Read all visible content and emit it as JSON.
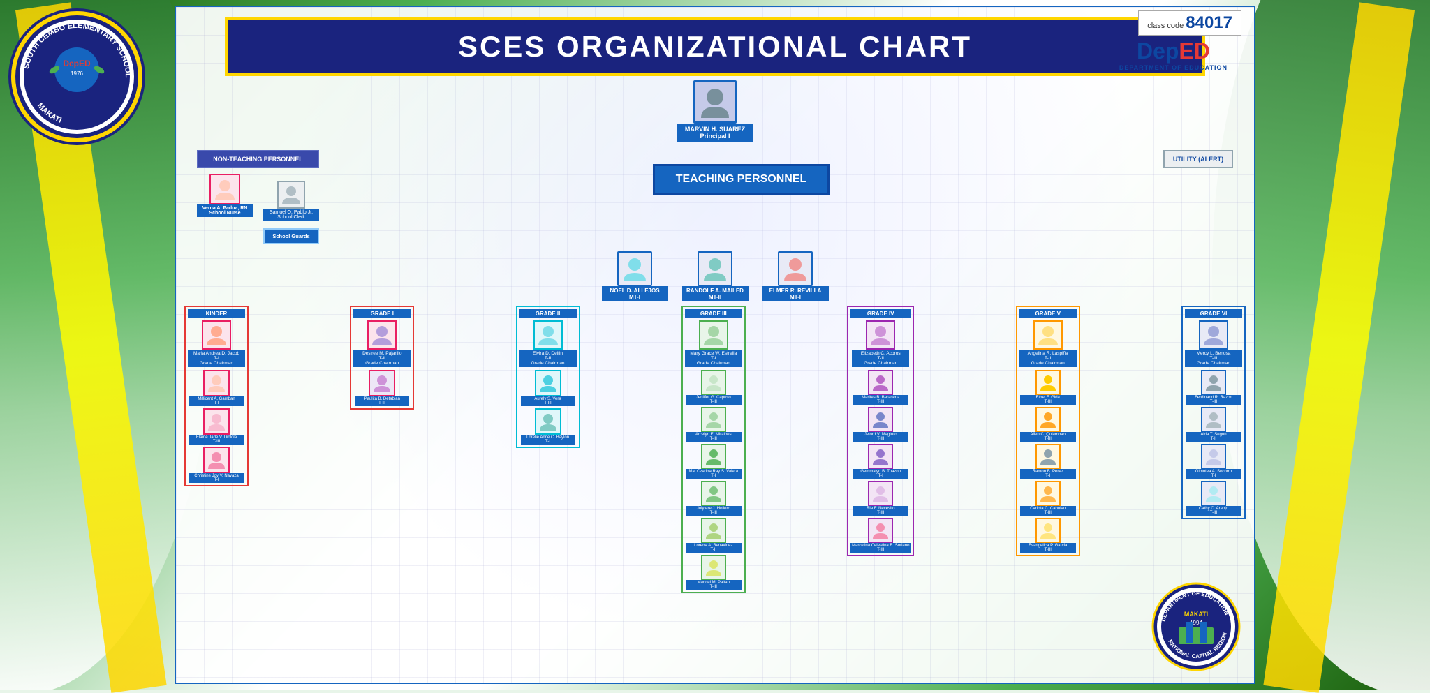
{
  "title": "SCES ORGANIZATIONAL CHART",
  "school_name": "SOUTH CEMBO ELEMENTARY SCHOOL",
  "class_code": "84017",
  "principal": {
    "name": "MARVIN H. SUAREZ",
    "role": "Principal I"
  },
  "non_teaching": {
    "label": "NON-TEACHING PERSONNEL"
  },
  "utility": {
    "label": "UTILITY (ALERT)"
  },
  "school_nurse": {
    "name": "Verna A. Padua, RN",
    "role": "School Nurse"
  },
  "school_clerk": {
    "name": "Samuel O. Pablo Jr.",
    "role": "School Clerk"
  },
  "school_guards": {
    "label": "School Guards"
  },
  "teaching_personnel": {
    "label": "TEACHING PERSONNEL"
  },
  "mt": [
    {
      "name": "NOEL D. ALLEJOS",
      "role": "MT-I"
    },
    {
      "name": "RANDOLF A. MAILED",
      "role": "MT-II"
    },
    {
      "name": "ELMER R. REVILLA",
      "role": "MT-I"
    }
  ],
  "grades": [
    {
      "label": "KINDER",
      "chairman": {
        "name": "Maria Andrea D. Jacob",
        "rank": "T-I",
        "sub": "Grade Chairman"
      },
      "teachers": [
        {
          "name": "Millicent A. Gamban",
          "rank": "T-I"
        },
        {
          "name": "Elaine Jade V. Diolola",
          "rank": "T-III"
        },
        {
          "name": "Christine Joy V. Navaza",
          "rank": "T-I"
        }
      ]
    },
    {
      "label": "GRADE I",
      "chairman": {
        "name": "Desiree M. Pajarillo",
        "rank": "T-II",
        "sub": "Grade Chairman"
      },
      "teachers": [
        {
          "name": "Paulita B. Detabian",
          "rank": "T-III"
        }
      ]
    },
    {
      "label": "GRADE II",
      "chairman": {
        "name": "Elvira D. Delfin",
        "rank": "T-II",
        "sub": "Grade Chairman"
      },
      "teachers": [
        {
          "name": "Aurely S. Vera",
          "rank": "T-III"
        },
        {
          "name": "Lorelie Anne C. Baylon",
          "rank": "T-I"
        }
      ]
    },
    {
      "label": "GRADE III",
      "chairman": {
        "name": "Mary Grace W. Estrella",
        "rank": "T-I",
        "sub": "Grade Chairman"
      },
      "teachers": [
        {
          "name": "Jeniffer G. Capuso",
          "rank": "T-III"
        },
        {
          "name": "Arcelyn E. Miralpes",
          "rank": "T-III"
        },
        {
          "name": "Ma. Czarina Ray S. Valera",
          "rank": "T-I"
        },
        {
          "name": "Julytere J. Hollero",
          "rank": "T-III"
        },
        {
          "name": "Lorena A. Benavidez",
          "rank": "T-II"
        },
        {
          "name": "Maricel M. Paitan",
          "rank": "T-III"
        }
      ]
    },
    {
      "label": "GRADE IV",
      "chairman": {
        "name": "Elizabeth C. Acoros",
        "rank": "T-II",
        "sub": "Grade Chairman"
      },
      "teachers": [
        {
          "name": "Marites B. Baracena",
          "rank": "T-III"
        },
        {
          "name": "Jelord V. Magturo",
          "rank": "T-III"
        },
        {
          "name": "Gemmalyn B. Tuazon",
          "rank": "T-I"
        },
        {
          "name": "Ria F. Necesito",
          "rank": "T-III"
        },
        {
          "name": "Marcelina Celestina B. Soriano",
          "rank": "T-III"
        }
      ]
    },
    {
      "label": "GRADE V",
      "chairman": {
        "name": "Angelina R. Laspiña",
        "rank": "T-II",
        "sub": "Grade Chairman"
      },
      "teachers": [
        {
          "name": "Ethel F. Gida",
          "rank": "T-III"
        },
        {
          "name": "Allen C. Quiambao",
          "rank": "T-III"
        },
        {
          "name": "Ramon B. Perez",
          "rank": "T-I"
        },
        {
          "name": "Carlota C. Cabulao",
          "rank": "T-III"
        },
        {
          "name": "Evangelica P. Garcia",
          "rank": "T-III"
        }
      ]
    },
    {
      "label": "GRADE VI",
      "chairman": {
        "name": "Mercy L. Benosa",
        "rank": "T-III",
        "sub": "Grade Chairman"
      },
      "teachers": [
        {
          "name": "Ferdinand R. Razon",
          "rank": "T-III"
        },
        {
          "name": "Aida T. Segun",
          "rank": "T-II"
        },
        {
          "name": "Gimotea A. Socorro",
          "rank": "T-I"
        },
        {
          "name": "Cathy C. Araojo",
          "rank": "T-III"
        }
      ]
    }
  ],
  "deped": "DepEd",
  "deped_full": "DEPARTMENT OF EDUCATION",
  "makati_year": "1994"
}
